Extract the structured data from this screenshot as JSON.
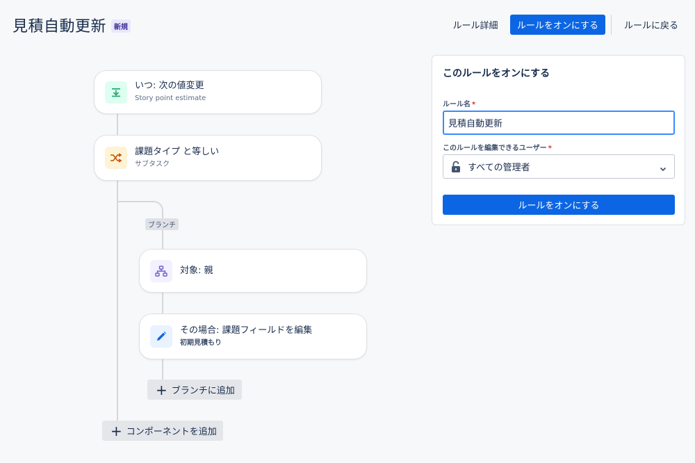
{
  "header": {
    "title": "見積自動更新",
    "badge": "新規",
    "rule_details_label": "ルール詳細",
    "enable_label": "ルールをオンにする",
    "back_label": "ルールに戻る"
  },
  "flow": {
    "trigger": {
      "title": "いつ: 次の値変更",
      "subtitle": "Story point estimate",
      "icon": "field-change-icon",
      "color": "#22a06b"
    },
    "condition": {
      "title": "課題タイプ と等しい",
      "subtitle": "サブタスク",
      "icon": "shuffle-icon",
      "color": "#c25100"
    },
    "branch_label": "ブランチ",
    "branch": {
      "title": "対象: 親",
      "icon": "hierarchy-icon",
      "color": "#6e5dc6"
    },
    "action": {
      "title": "その場合: 課題フィールドを編集",
      "subtitle": "初期見積もり",
      "icon": "pencil-icon",
      "color": "#0c66e4"
    },
    "add_to_branch_label": "ブランチに追加",
    "add_component_label": "コンポーネントを追加"
  },
  "panel": {
    "title": "このルールをオンにする",
    "name_label": "ルール名",
    "name_value": "見積自動更新",
    "editors_label": "このルールを編集できるユーザー",
    "required_marker": "*",
    "editors_value": "すべての管理者",
    "submit_label": "ルールをオンにする"
  },
  "colors": {
    "primary": "#0c66e4",
    "badge_bg": "#eae6ff",
    "badge_fg": "#403294"
  }
}
